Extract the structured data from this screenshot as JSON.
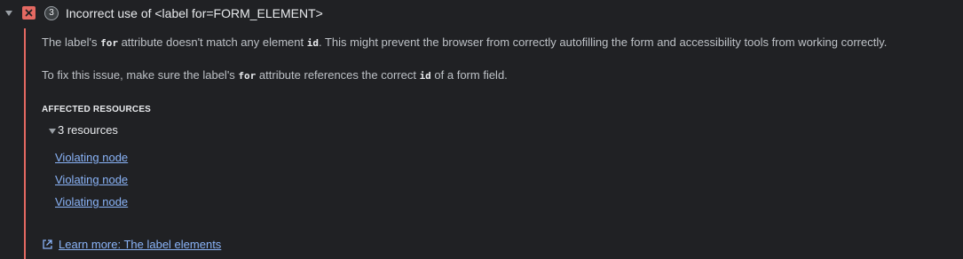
{
  "issue": {
    "count": "3",
    "title": "Incorrect use of <label for=FORM_ELEMENT>",
    "colors": {
      "error": "#e46962",
      "link": "#8ab4f8",
      "background": "#202124"
    },
    "icons": {
      "toggle": "chevron-down-icon",
      "badge": "error-x-icon"
    }
  },
  "description": {
    "p1_a": "The label's ",
    "p1_code1": "for",
    "p1_b": " attribute doesn't match any element ",
    "p1_code2": "id",
    "p1_c": ". This might prevent the browser from correctly autofilling the form and accessibility tools from working correctly.",
    "p2_a": "To fix this issue, make sure the label's ",
    "p2_code1": "for",
    "p2_b": " attribute references the correct ",
    "p2_code2": "id",
    "p2_c": " of a form field."
  },
  "affected": {
    "heading": "AFFECTED RESOURCES",
    "resources_label": "3 resources",
    "nodes": [
      "Violating node",
      "Violating node",
      "Violating node"
    ]
  },
  "learn_more": {
    "icon": "external-link-icon",
    "label": "Learn more: The label elements"
  }
}
